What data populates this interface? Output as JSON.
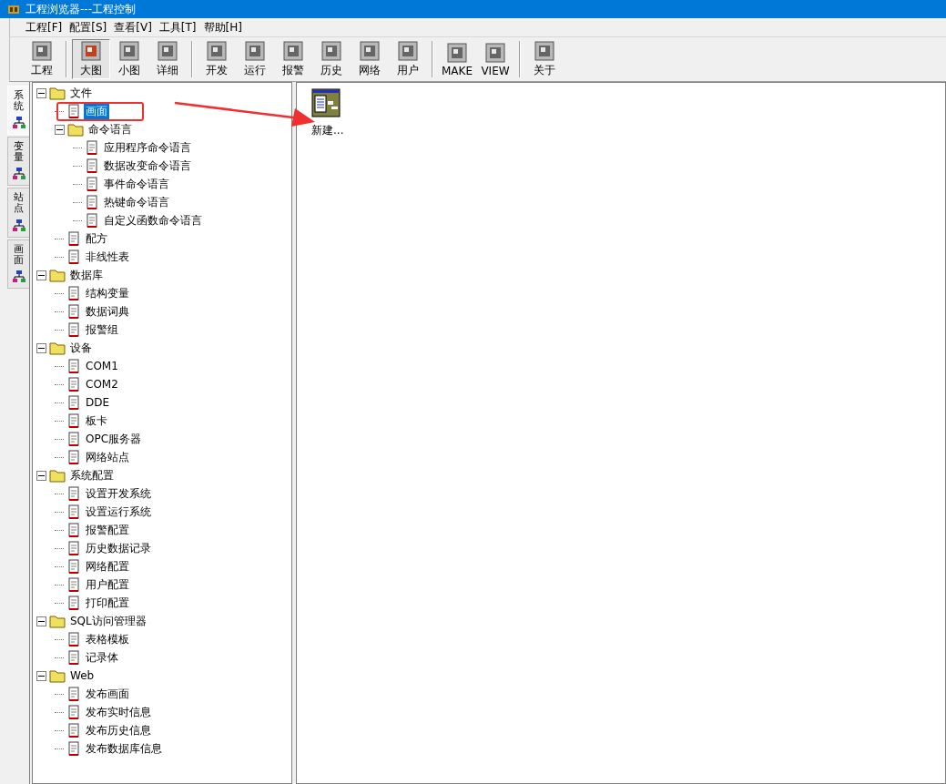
{
  "window": {
    "title": "工程浏览器---工程控制"
  },
  "menu": [
    "工程[F]",
    "配置[S]",
    "查看[V]",
    "工具[T]",
    "帮助[H]"
  ],
  "toolbar": [
    [
      {
        "label": "工程",
        "selected": false
      }
    ],
    [
      {
        "label": "大图",
        "selected": true
      },
      {
        "label": "小图",
        "selected": false
      },
      {
        "label": "详细",
        "selected": false
      }
    ],
    [
      {
        "label": "开发",
        "selected": false
      },
      {
        "label": "运行",
        "selected": false
      },
      {
        "label": "报警",
        "selected": false
      },
      {
        "label": "历史",
        "selected": false
      },
      {
        "label": "网络",
        "selected": false
      },
      {
        "label": "用户",
        "selected": false
      }
    ],
    [
      {
        "label": "MAKE",
        "selected": false
      },
      {
        "label": "VIEW",
        "selected": false
      }
    ],
    [
      {
        "label": "关于",
        "selected": false
      }
    ]
  ],
  "side_tabs": [
    {
      "label": "系统",
      "selected": true
    },
    {
      "label": "变量",
      "selected": false
    },
    {
      "label": "站点",
      "selected": false
    },
    {
      "label": "画面",
      "selected": false
    }
  ],
  "tree": [
    {
      "label": "文件",
      "selected": false,
      "expanded": true,
      "children": [
        {
          "label": "画面",
          "selected": true
        },
        {
          "label": "命令语言",
          "selected": false,
          "expanded": true,
          "children": [
            {
              "label": "应用程序命令语言",
              "selected": false
            },
            {
              "label": "数据改变命令语言",
              "selected": false
            },
            {
              "label": "事件命令语言",
              "selected": false
            },
            {
              "label": "热键命令语言",
              "selected": false
            },
            {
              "label": "自定义函数命令语言",
              "selected": false
            }
          ]
        },
        {
          "label": "配方",
          "selected": false
        },
        {
          "label": "非线性表",
          "selected": false
        }
      ]
    },
    {
      "label": "数据库",
      "selected": false,
      "expanded": true,
      "children": [
        {
          "label": "结构变量",
          "selected": false
        },
        {
          "label": "数据词典",
          "selected": false
        },
        {
          "label": "报警组",
          "selected": false
        }
      ]
    },
    {
      "label": "设备",
      "selected": false,
      "expanded": true,
      "children": [
        {
          "label": "COM1",
          "selected": false
        },
        {
          "label": "COM2",
          "selected": false
        },
        {
          "label": "DDE",
          "selected": false
        },
        {
          "label": "板卡",
          "selected": false
        },
        {
          "label": "OPC服务器",
          "selected": false
        },
        {
          "label": "网络站点",
          "selected": false
        }
      ]
    },
    {
      "label": "系统配置",
      "selected": false,
      "expanded": true,
      "children": [
        {
          "label": "设置开发系统",
          "selected": false
        },
        {
          "label": "设置运行系统",
          "selected": false
        },
        {
          "label": "报警配置",
          "selected": false
        },
        {
          "label": "历史数据记录",
          "selected": false
        },
        {
          "label": "网络配置",
          "selected": false
        },
        {
          "label": "用户配置",
          "selected": false
        },
        {
          "label": "打印配置",
          "selected": false
        }
      ]
    },
    {
      "label": "SQL访问管理器",
      "selected": false,
      "expanded": true,
      "children": [
        {
          "label": "表格模板",
          "selected": false
        },
        {
          "label": "记录体",
          "selected": false
        }
      ]
    },
    {
      "label": "Web",
      "selected": false,
      "expanded": true,
      "children": [
        {
          "label": "发布画面",
          "selected": false
        },
        {
          "label": "发布实时信息",
          "selected": false
        },
        {
          "label": "发布历史信息",
          "selected": false
        },
        {
          "label": "发布数据库信息",
          "selected": false
        }
      ]
    }
  ],
  "content": {
    "items": [
      {
        "label": "新建..."
      }
    ]
  }
}
